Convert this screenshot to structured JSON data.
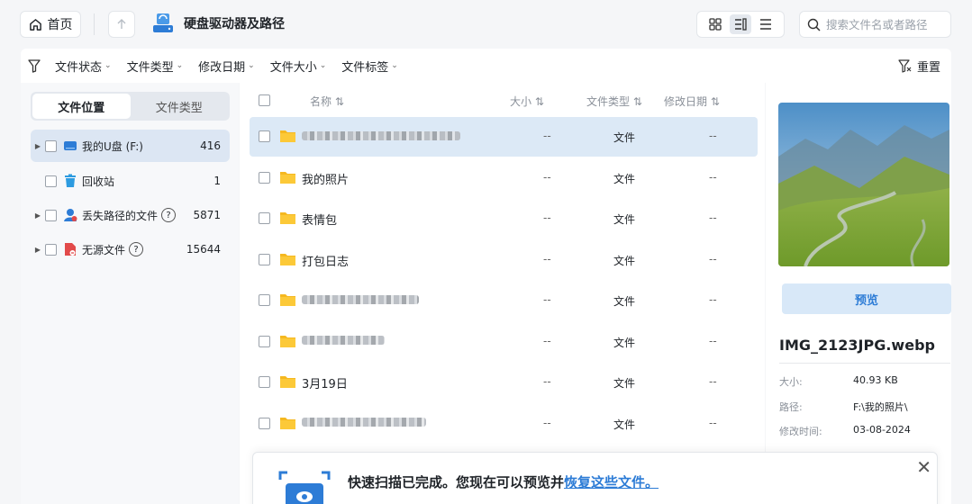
{
  "topbar": {
    "home_label": "首页",
    "path_title": "硬盘驱动器及路径",
    "search_placeholder": "搜索文件名或者路径"
  },
  "filters": {
    "items": [
      "文件状态",
      "文件类型",
      "修改日期",
      "文件大小",
      "文件标签"
    ],
    "reset_label": "重置"
  },
  "left": {
    "tabs": [
      "文件位置",
      "文件类型"
    ],
    "active_tab": 0,
    "tree": [
      {
        "label": "我的U盘 (F:)",
        "count": "416",
        "icon": "usb-drive-icon",
        "expandable": true,
        "selected": true
      },
      {
        "label": "回收站",
        "count": "1",
        "icon": "recycle-bin-icon",
        "expandable": false,
        "selected": false
      },
      {
        "label": "丢失路径的文件",
        "count": "5871",
        "icon": "lost-path-icon",
        "expandable": true,
        "selected": false,
        "help": "?"
      },
      {
        "label": "无源文件",
        "count": "15644",
        "icon": "orphan-file-icon",
        "expandable": true,
        "selected": false,
        "help": "?"
      }
    ]
  },
  "list": {
    "headers": {
      "name": "名称 ⇅",
      "size": "大小 ⇅",
      "type": "文件类型 ⇅",
      "date": "修改日期 ⇅"
    },
    "rows": [
      {
        "name": "",
        "blurred": true,
        "size": "--",
        "type": "文件",
        "date": "--",
        "selected": true
      },
      {
        "name": "我的照片",
        "blurred": false,
        "size": "--",
        "type": "文件",
        "date": "--",
        "selected": false
      },
      {
        "name": "表情包",
        "blurred": false,
        "size": "--",
        "type": "文件",
        "date": "--",
        "selected": false
      },
      {
        "name": "打包日志",
        "blurred": false,
        "size": "--",
        "type": "文件",
        "date": "--",
        "selected": false
      },
      {
        "name": "",
        "blurred": true,
        "size": "--",
        "type": "文件",
        "date": "--",
        "selected": false
      },
      {
        "name": "",
        "blurred": true,
        "size": "--",
        "type": "文件",
        "date": "--",
        "selected": false
      },
      {
        "name": "3月19日",
        "blurred": false,
        "size": "--",
        "type": "文件",
        "date": "--",
        "selected": false
      },
      {
        "name": "",
        "blurred": true,
        "size": "--",
        "type": "文件",
        "date": "--",
        "selected": false
      }
    ]
  },
  "details": {
    "preview_label": "预览",
    "file_name": "IMG_2123JPG.webp",
    "size_key": "大小:",
    "size_value": "40.93 KB",
    "path_key": "路径:",
    "path_value": "F:\\我的照片\\",
    "mtime_key": "修改时间:",
    "mtime_value": "03-08-2024"
  },
  "toast": {
    "message": "快速扫描已完成。您现在可以预览并",
    "link": "恢复这些文件。"
  },
  "colors": {
    "accent": "#2d7cd6",
    "selected_row": "#dce9f6",
    "folder": "#f5b820"
  }
}
